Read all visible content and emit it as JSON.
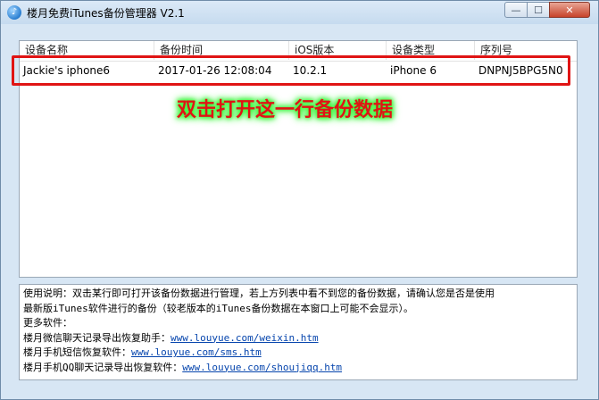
{
  "window": {
    "title": "楼月免费iTunes备份管理器 V2.1",
    "controls": {
      "minimize": "—",
      "maximize": "☐",
      "close": "✕"
    }
  },
  "list": {
    "columns": [
      "设备名称",
      "备份时间",
      "iOS版本",
      "设备类型",
      "序列号"
    ],
    "rows": [
      [
        "Jackie's iphone6",
        "2017-01-26 12:08:04",
        "10.2.1",
        "iPhone 6",
        "DNPNJ5BPG5N0"
      ]
    ]
  },
  "annotation": {
    "hint": "双击打开这一行备份数据"
  },
  "help": {
    "line1": "使用说明：双击某行即可打开该备份数据进行管理，若上方列表中看不到您的备份数据，请确认您是否是使用",
    "line2": "最新版iTunes软件进行的备份（较老版本的iTunes备份数据在本窗口上可能不会显示）。",
    "line3": "更多软件：",
    "links": [
      {
        "label": "楼月微信聊天记录导出恢复助手：",
        "url": "www.louyue.com/weixin.htm"
      },
      {
        "label": "楼月手机短信恢复软件：",
        "url": "www.louyue.com/sms.htm"
      },
      {
        "label": "楼月手机QQ聊天记录导出恢复软件：",
        "url": "www.louyue.com/shoujiqq.htm"
      }
    ]
  },
  "colors": {
    "accent_red": "#e01414",
    "glow_green": "#3dff3d",
    "link_blue": "#0645ad",
    "window_bg": "#d7e6f4"
  }
}
